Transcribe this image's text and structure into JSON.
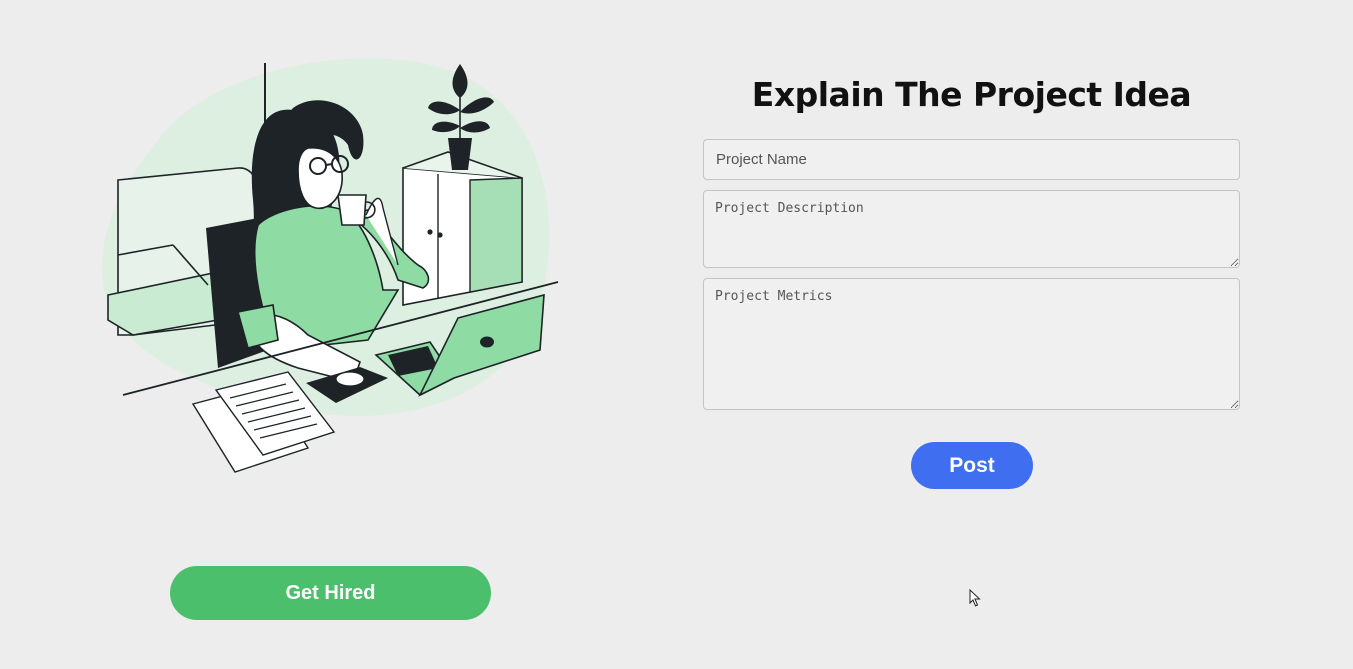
{
  "illustration": {
    "icon": "woman-working-at-laptop-illustration",
    "accent_color": "#8fdba4",
    "blob_color": "#dcefe1"
  },
  "sidebar": {
    "get_hired_label": "Get Hired",
    "get_hired_color": "#4bbf6b"
  },
  "form": {
    "title": "Explain The Project Idea",
    "project_name_placeholder": "Project Name",
    "project_description_placeholder": "Project Description",
    "project_metrics_placeholder": "Project Metrics",
    "post_label": "Post",
    "post_color": "#3f6ef0"
  }
}
